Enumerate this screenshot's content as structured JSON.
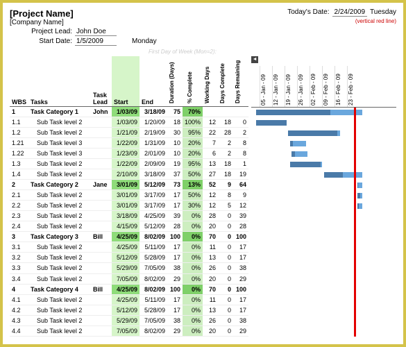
{
  "header": {
    "project_name": "[Project Name]",
    "company_name": "[Company Name]",
    "today_label": "Today's Date:",
    "today_date": "2/24/2009",
    "today_day": "Tuesday",
    "vertical_note": "(vertical red line)",
    "lead_label": "Project Lead:",
    "lead_value": "John Doe",
    "start_label": "Start Date:",
    "start_value": "1/5/2009",
    "start_day": "Monday",
    "first_day_note": "First Day of Week (Mon=2):"
  },
  "columns": {
    "wbs": "WBS",
    "tasks": "Tasks",
    "lead": "Task Lead",
    "start": "Start",
    "end": "End",
    "duration": "Duration (Days)",
    "pct": "% Complete",
    "workdays": "Working Days",
    "days_complete": "Days Complete",
    "days_remaining": "Days Remaining"
  },
  "gantt_dates": [
    "05 - Jan - 09",
    "12 - Jan - 09",
    "19 - Jan - 09",
    "26 - Jan - 09",
    "02 - Feb - 09",
    "09 - Feb - 09",
    "16 - Feb - 09",
    "23 - Feb - 09"
  ],
  "chart_data": {
    "type": "table",
    "title": "Project Schedule / Gantt",
    "rows": [
      {
        "cat": true,
        "wbs": "1",
        "task": "Task Category 1",
        "lead": "John",
        "start": "1/03/09",
        "end": "3/18/09",
        "dur": 75,
        "pct": "70%",
        "wd": "",
        "dc": "",
        "dr": ""
      },
      {
        "cat": false,
        "wbs": "1.1",
        "task": "Sub Task level 2",
        "lead": "",
        "start": "1/03/09",
        "end": "1/20/09",
        "dur": 18,
        "pct": "100%",
        "wd": 12,
        "dc": 18,
        "dr": 0
      },
      {
        "cat": false,
        "wbs": "1.2",
        "task": "Sub Task level 2",
        "lead": "",
        "start": "1/21/09",
        "end": "2/19/09",
        "dur": 30,
        "pct": "95%",
        "wd": 22,
        "dc": 28,
        "dr": 2
      },
      {
        "cat": false,
        "wbs": "1.21",
        "task": "Sub Task level 3",
        "lead": "",
        "start": "1/22/09",
        "end": "1/31/09",
        "dur": 10,
        "pct": "20%",
        "wd": 7,
        "dc": 2,
        "dr": 8
      },
      {
        "cat": false,
        "wbs": "1.22",
        "task": "Sub Task level 3",
        "lead": "",
        "start": "1/23/09",
        "end": "2/01/09",
        "dur": 10,
        "pct": "20%",
        "wd": 6,
        "dc": 2,
        "dr": 8
      },
      {
        "cat": false,
        "wbs": "1.3",
        "task": "Sub Task level 2",
        "lead": "",
        "start": "1/22/09",
        "end": "2/09/09",
        "dur": 19,
        "pct": "95%",
        "wd": 13,
        "dc": 18,
        "dr": 1
      },
      {
        "cat": false,
        "wbs": "1.4",
        "task": "Sub Task level 2",
        "lead": "",
        "start": "2/10/09",
        "end": "3/18/09",
        "dur": 37,
        "pct": "50%",
        "wd": 27,
        "dc": 18,
        "dr": 19
      },
      {
        "cat": true,
        "wbs": "2",
        "task": "Task Category 2",
        "lead": "Jane",
        "start": "3/01/09",
        "end": "5/12/09",
        "dur": 73,
        "pct": "13%",
        "wd": 52,
        "dc": 9,
        "dr": 64
      },
      {
        "cat": false,
        "wbs": "2.1",
        "task": "Sub Task level 2",
        "lead": "",
        "start": "3/01/09",
        "end": "3/17/09",
        "dur": 17,
        "pct": "50%",
        "wd": 12,
        "dc": 8,
        "dr": 9
      },
      {
        "cat": false,
        "wbs": "2.2",
        "task": "Sub Task level 2",
        "lead": "",
        "start": "3/01/09",
        "end": "3/17/09",
        "dur": 17,
        "pct": "30%",
        "wd": 12,
        "dc": 5,
        "dr": 12
      },
      {
        "cat": false,
        "wbs": "2.3",
        "task": "Sub Task level 2",
        "lead": "",
        "start": "3/18/09",
        "end": "4/25/09",
        "dur": 39,
        "pct": "0%",
        "wd": 28,
        "dc": 0,
        "dr": 39
      },
      {
        "cat": false,
        "wbs": "2.4",
        "task": "Sub Task level 2",
        "lead": "",
        "start": "4/15/09",
        "end": "5/12/09",
        "dur": 28,
        "pct": "0%",
        "wd": 20,
        "dc": 0,
        "dr": 28
      },
      {
        "cat": true,
        "wbs": "3",
        "task": "Task Category 3",
        "lead": "Bill",
        "start": "4/25/09",
        "end": "8/02/09",
        "dur": 100,
        "pct": "0%",
        "wd": 70,
        "dc": 0,
        "dr": 100
      },
      {
        "cat": false,
        "wbs": "3.1",
        "task": "Sub Task level 2",
        "lead": "",
        "start": "4/25/09",
        "end": "5/11/09",
        "dur": 17,
        "pct": "0%",
        "wd": 11,
        "dc": 0,
        "dr": 17
      },
      {
        "cat": false,
        "wbs": "3.2",
        "task": "Sub Task level 2",
        "lead": "",
        "start": "5/12/09",
        "end": "5/28/09",
        "dur": 17,
        "pct": "0%",
        "wd": 13,
        "dc": 0,
        "dr": 17
      },
      {
        "cat": false,
        "wbs": "3.3",
        "task": "Sub Task level 2",
        "lead": "",
        "start": "5/29/09",
        "end": "7/05/09",
        "dur": 38,
        "pct": "0%",
        "wd": 26,
        "dc": 0,
        "dr": 38
      },
      {
        "cat": false,
        "wbs": "3.4",
        "task": "Sub Task level 2",
        "lead": "",
        "start": "7/05/09",
        "end": "8/02/09",
        "dur": 29,
        "pct": "0%",
        "wd": 20,
        "dc": 0,
        "dr": 29
      },
      {
        "cat": true,
        "wbs": "4",
        "task": "Task Category 4",
        "lead": "Bill",
        "start": "4/25/09",
        "end": "8/02/09",
        "dur": 100,
        "pct": "0%",
        "wd": 70,
        "dc": 0,
        "dr": 100
      },
      {
        "cat": false,
        "wbs": "4.1",
        "task": "Sub Task level 2",
        "lead": "",
        "start": "4/25/09",
        "end": "5/11/09",
        "dur": 17,
        "pct": "0%",
        "wd": 11,
        "dc": 0,
        "dr": 17
      },
      {
        "cat": false,
        "wbs": "4.2",
        "task": "Sub Task level 2",
        "lead": "",
        "start": "5/12/09",
        "end": "5/28/09",
        "dur": 17,
        "pct": "0%",
        "wd": 13,
        "dc": 0,
        "dr": 17
      },
      {
        "cat": false,
        "wbs": "4.3",
        "task": "Sub Task level 2",
        "lead": "",
        "start": "5/29/09",
        "end": "7/05/09",
        "dur": 38,
        "pct": "0%",
        "wd": 26,
        "dc": 0,
        "dr": 38
      },
      {
        "cat": false,
        "wbs": "4.4",
        "task": "Sub Task level 2",
        "lead": "",
        "start": "7/05/09",
        "end": "8/02/09",
        "dur": 29,
        "pct": "0%",
        "wd": 20,
        "dc": 0,
        "dr": 29
      }
    ]
  }
}
